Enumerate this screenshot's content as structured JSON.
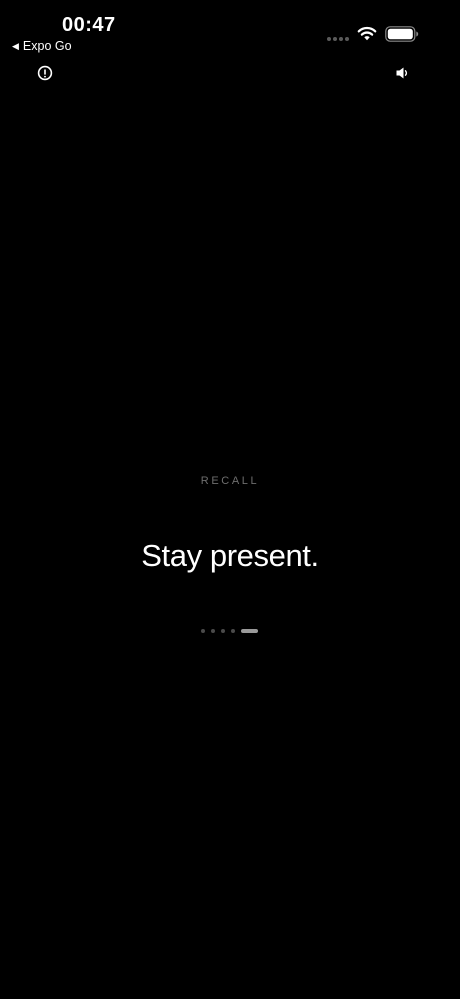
{
  "status_bar": {
    "time": "00:47",
    "back_app_label": "Expo Go",
    "icons": [
      "cellular-signal-icon",
      "wifi-icon",
      "battery-icon"
    ]
  },
  "toolbar": {
    "info_icon": "info-icon",
    "sound_icon": "speaker-icon"
  },
  "main": {
    "eyebrow": "RECALL",
    "headline": "Stay present."
  },
  "pager": {
    "total_pages": 5,
    "active_page": 5
  },
  "colors": {
    "background": "#000000",
    "text": "#ffffff",
    "muted": "#6e6e6e"
  }
}
